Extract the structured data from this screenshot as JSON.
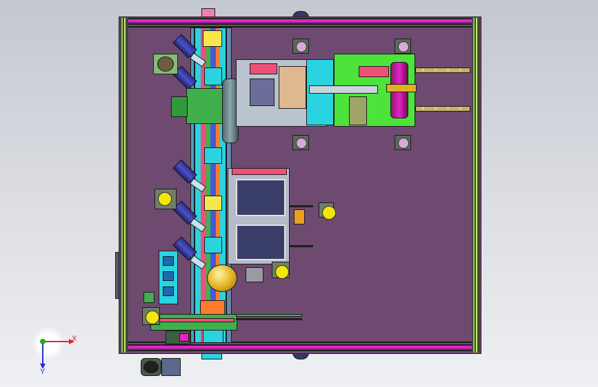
{
  "viewport": {
    "background_top": "#c4c7cf",
    "background_bottom": "#eef0f3"
  },
  "model": {
    "plate_color": "#6e4a71",
    "rail_accent": "#e820c8",
    "conveyor_colors": [
      "#2ad3e0",
      "#f05078",
      "#f6e84a",
      "#38b848",
      "#4658d8",
      "#ff7a2a"
    ]
  },
  "triad": {
    "x_label": "X",
    "y_label": "Y",
    "x_color": "#e8252a",
    "y_color": "#2b2bd6",
    "origin_color": "#22aa22"
  }
}
